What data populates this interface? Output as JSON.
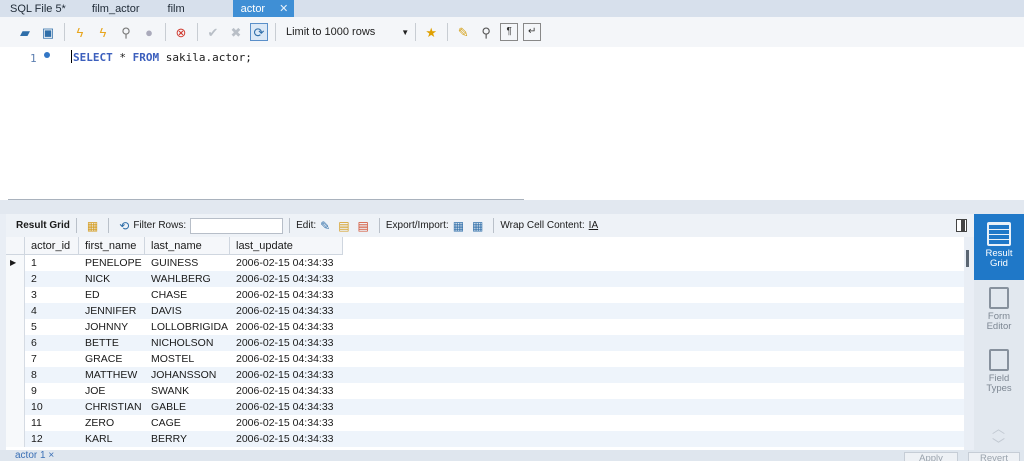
{
  "tabs": [
    {
      "label": "SQL File 5*",
      "active": false
    },
    {
      "label": "film_actor",
      "active": false
    },
    {
      "label": "film",
      "active": false
    },
    {
      "label": "actor",
      "active": true
    }
  ],
  "toolbar": {
    "limit_select": "Limit to 1000 rows",
    "icons": [
      "open-folder-icon",
      "save-icon",
      "execute-icon",
      "execute-current-icon",
      "explain-icon",
      "stop-icon",
      "toggle-error-icon",
      "commit-icon",
      "rollback-icon",
      "autocommit-icon",
      "bookmark-icon",
      "beautify-icon",
      "find-icon",
      "invisible-chars-icon",
      "wrap-icon"
    ]
  },
  "editor": {
    "line_number": "1",
    "code_keyword1": "SELECT",
    "code_mid": " * ",
    "code_keyword2": "FROM",
    "code_rest": " sakila.actor;"
  },
  "results_toolbar": {
    "result_grid_label": "Result Grid",
    "filter_label": "Filter Rows:",
    "filter_value": "",
    "edit_label": "Edit:",
    "export_label": "Export/Import:",
    "wrap_label": "Wrap Cell Content:"
  },
  "grid": {
    "columns": [
      "actor_id",
      "first_name",
      "last_name",
      "last_update"
    ],
    "rows": [
      [
        "1",
        "PENELOPE",
        "GUINESS",
        "2006-02-15 04:34:33"
      ],
      [
        "2",
        "NICK",
        "WAHLBERG",
        "2006-02-15 04:34:33"
      ],
      [
        "3",
        "ED",
        "CHASE",
        "2006-02-15 04:34:33"
      ],
      [
        "4",
        "JENNIFER",
        "DAVIS",
        "2006-02-15 04:34:33"
      ],
      [
        "5",
        "JOHNNY",
        "LOLLOBRIGIDA",
        "2006-02-15 04:34:33"
      ],
      [
        "6",
        "BETTE",
        "NICHOLSON",
        "2006-02-15 04:34:33"
      ],
      [
        "7",
        "GRACE",
        "MOSTEL",
        "2006-02-15 04:34:33"
      ],
      [
        "8",
        "MATTHEW",
        "JOHANSSON",
        "2006-02-15 04:34:33"
      ],
      [
        "9",
        "JOE",
        "SWANK",
        "2006-02-15 04:34:33"
      ],
      [
        "10",
        "CHRISTIAN",
        "GABLE",
        "2006-02-15 04:34:33"
      ],
      [
        "11",
        "ZERO",
        "CAGE",
        "2006-02-15 04:34:33"
      ],
      [
        "12",
        "KARL",
        "BERRY",
        "2006-02-15 04:34:33"
      ]
    ]
  },
  "side_panel": {
    "result_grid": [
      "Result",
      "Grid"
    ],
    "form_editor": [
      "Form",
      "Editor"
    ],
    "field_types": [
      "Field",
      "Types"
    ]
  },
  "bottom": {
    "result_tab": "actor 1 ×",
    "apply": "Apply",
    "revert": "Revert"
  },
  "colors": {
    "active_tab": "#3f8fd5",
    "keyword": "#3c5fbd",
    "side_active": "#1f78c8"
  }
}
